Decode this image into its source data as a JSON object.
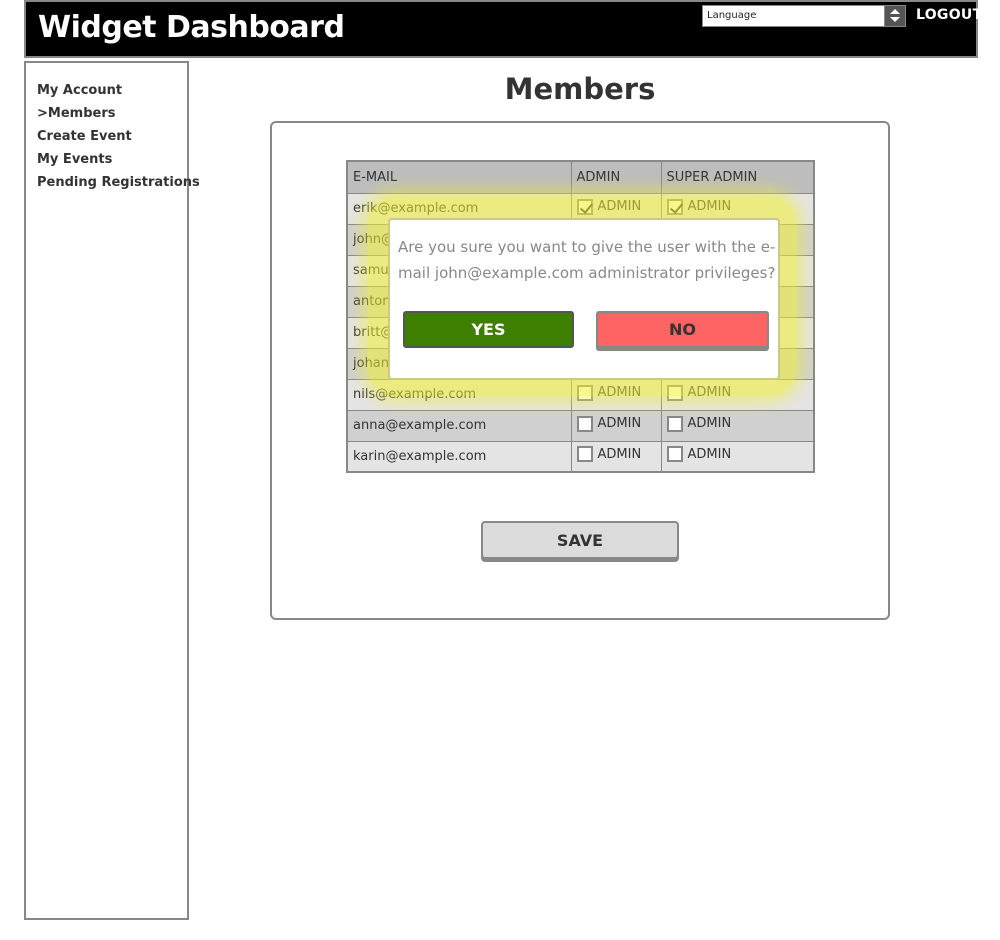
{
  "header": {
    "title": "Widget Dashboard",
    "language_placeholder": "Language",
    "logout_label": "LOGOUT"
  },
  "sidebar": {
    "items": [
      {
        "label": "My Account"
      },
      {
        "label": ">Members"
      },
      {
        "label": "Create Event"
      },
      {
        "label": "My Events"
      },
      {
        "label": "Pending Registrations"
      }
    ]
  },
  "main": {
    "title": "Members",
    "table": {
      "headers": [
        "E-MAIL",
        "ADMIN",
        "SUPER ADMIN"
      ],
      "checkbox_label": "ADMIN",
      "rows": [
        {
          "email": "erik@example.com",
          "admin": true,
          "super_admin": true
        },
        {
          "email": "john@example.com",
          "admin": false,
          "super_admin": false
        },
        {
          "email": "samuel@example.com",
          "admin": false,
          "super_admin": false
        },
        {
          "email": "anton@example.com",
          "admin": false,
          "super_admin": false
        },
        {
          "email": "britt@example.com",
          "admin": false,
          "super_admin": false
        },
        {
          "email": "johan@example.com",
          "admin": false,
          "super_admin": false
        },
        {
          "email": "nils@example.com",
          "admin": false,
          "super_admin": false
        },
        {
          "email": "anna@example.com",
          "admin": false,
          "super_admin": false
        },
        {
          "email": "karin@example.com",
          "admin": false,
          "super_admin": false
        }
      ]
    },
    "save_label": "SAVE"
  },
  "dialog": {
    "message": "Are you sure you want to give the user with the e-mail john@example.com administrator privileges?",
    "yes_label": "YES",
    "no_label": "NO"
  },
  "colors": {
    "header_bg": "#000000",
    "yes_green": "#3e7e00",
    "no_red": "#ff6464",
    "highlight": "#f0f032"
  }
}
